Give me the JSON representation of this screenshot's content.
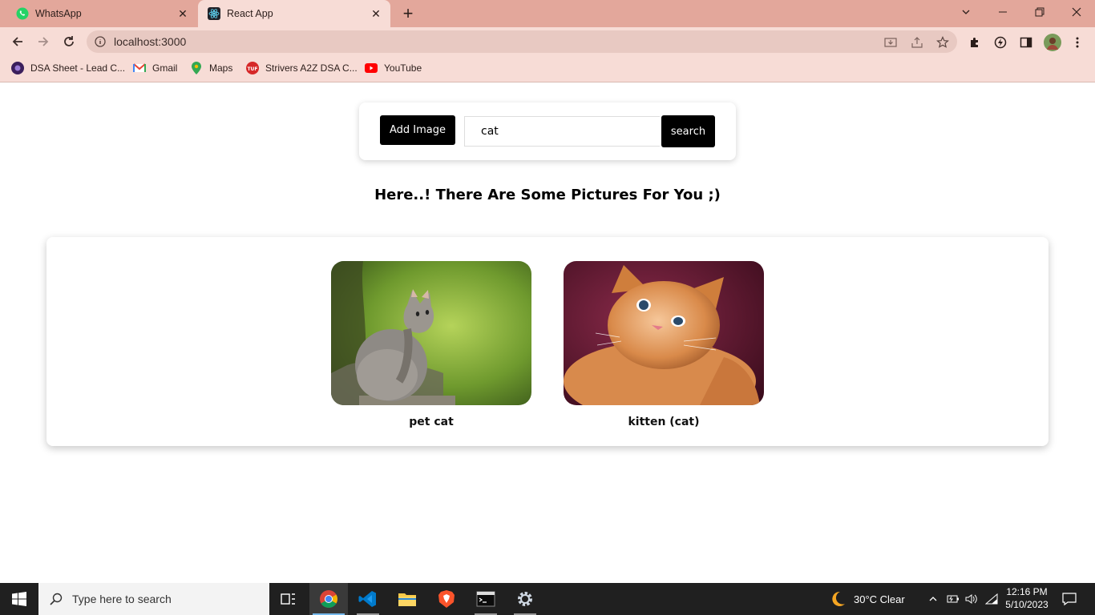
{
  "browser": {
    "tabs": [
      {
        "title": "WhatsApp",
        "active": false
      },
      {
        "title": "React App",
        "active": true
      }
    ],
    "address": "localhost:3000",
    "bookmarks": [
      {
        "label": "DSA Sheet - Lead C..."
      },
      {
        "label": "Gmail"
      },
      {
        "label": "Maps"
      },
      {
        "label": "Strivers A2Z DSA C..."
      },
      {
        "label": "YouTube"
      }
    ]
  },
  "page": {
    "add_button": "Add Image",
    "search_value": "cat",
    "search_button": "search",
    "heading": "Here..! There Are Some Pictures For You ;)",
    "pictures": [
      {
        "caption": "pet cat"
      },
      {
        "caption": "kitten (cat)"
      }
    ]
  },
  "taskbar": {
    "search_placeholder": "Type here to search",
    "weather": "30°C  Clear",
    "time": "12:16 PM",
    "date": "5/10/2023"
  },
  "colors": {
    "tab_strip": "#e3a79b",
    "toolbar": "#f7dcd6",
    "button_bg": "#000000",
    "taskbar": "#202020"
  }
}
